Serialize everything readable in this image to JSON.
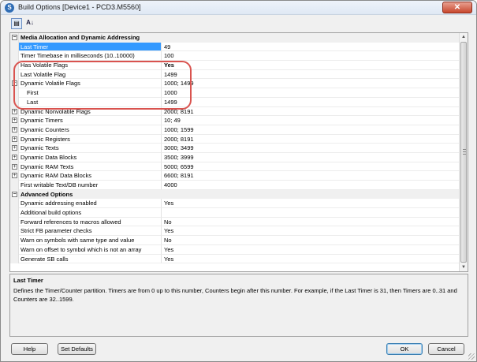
{
  "window": {
    "title": "Build Options [Device1 - PCD3.M5560]",
    "close_glyph": "✕"
  },
  "toolbar": {
    "categorized_icon": "categorized-icon",
    "alphabetical_icon": "sort-alphabetical-icon",
    "alphabetical_glyph": "A↓"
  },
  "grid": {
    "expand_glyph": "+",
    "collapse_glyph": "−",
    "rows": [
      {
        "type": "category",
        "label": "Media Allocation and Dynamic Addressing"
      },
      {
        "type": "prop",
        "name": "Last Timer",
        "value": "49",
        "selected": true
      },
      {
        "type": "prop",
        "name": "Timer Timebase in milliseconds (10..10000)",
        "value": "100"
      },
      {
        "type": "prop",
        "name": "Has Volatile Flags",
        "value": "Yes",
        "bold": true
      },
      {
        "type": "prop",
        "name": "Last Volatile Flag",
        "value": "1499"
      },
      {
        "type": "prop",
        "name": "Dynamic Volatile Flags",
        "value": "1000; 1499",
        "expander": "collapse"
      },
      {
        "type": "prop",
        "name": "First",
        "value": "1000",
        "sub": true
      },
      {
        "type": "prop",
        "name": "Last",
        "value": "1499",
        "sub": true
      },
      {
        "type": "prop",
        "name": "Dynamic Nonvolatile Flags",
        "value": "2000; 8191",
        "expander": "expand"
      },
      {
        "type": "prop",
        "name": "Dynamic Timers",
        "value": "10; 49",
        "expander": "expand"
      },
      {
        "type": "prop",
        "name": "Dynamic Counters",
        "value": "1000; 1599",
        "expander": "expand"
      },
      {
        "type": "prop",
        "name": "Dynamic Registers",
        "value": "2000; 8191",
        "expander": "expand"
      },
      {
        "type": "prop",
        "name": "Dynamic Texts",
        "value": "3000; 3499",
        "expander": "expand"
      },
      {
        "type": "prop",
        "name": "Dynamic Data Blocks",
        "value": "3500; 3999",
        "expander": "expand"
      },
      {
        "type": "prop",
        "name": "Dynamic RAM Texts",
        "value": "5000; 6599",
        "expander": "expand"
      },
      {
        "type": "prop",
        "name": "Dynamic RAM Data Blocks",
        "value": "6600; 8191",
        "expander": "expand"
      },
      {
        "type": "prop",
        "name": "First writable Text/DB number",
        "value": "4000"
      },
      {
        "type": "category",
        "label": "Advanced Options"
      },
      {
        "type": "prop",
        "name": "Dynamic addressing enabled",
        "value": "Yes"
      },
      {
        "type": "prop",
        "name": "Additional build options",
        "value": ""
      },
      {
        "type": "prop",
        "name": "Forward references to macros allowed",
        "value": "No"
      },
      {
        "type": "prop",
        "name": "Strict FB parameter checks",
        "value": "Yes"
      },
      {
        "type": "prop",
        "name": "Warn on symbols with same type and value",
        "value": "No"
      },
      {
        "type": "prop",
        "name": "Warn on offset to symbol which is not an array",
        "value": "Yes"
      },
      {
        "type": "prop",
        "name": "Generate SB calls",
        "value": "Yes"
      }
    ]
  },
  "description": {
    "title": "Last Timer",
    "text": "Defines the Timer/Counter partition. Timers are from 0 up to this number, Counters begin after this number. For example, if the Last Timer is 31, then Timers are 0..31 and Counters are 32..1599."
  },
  "buttons": {
    "help": "Help",
    "set_defaults": "Set Defaults",
    "ok": "OK",
    "cancel": "Cancel"
  },
  "colors": {
    "selection": "#3399ff",
    "highlight_annotation": "#d9534f"
  }
}
